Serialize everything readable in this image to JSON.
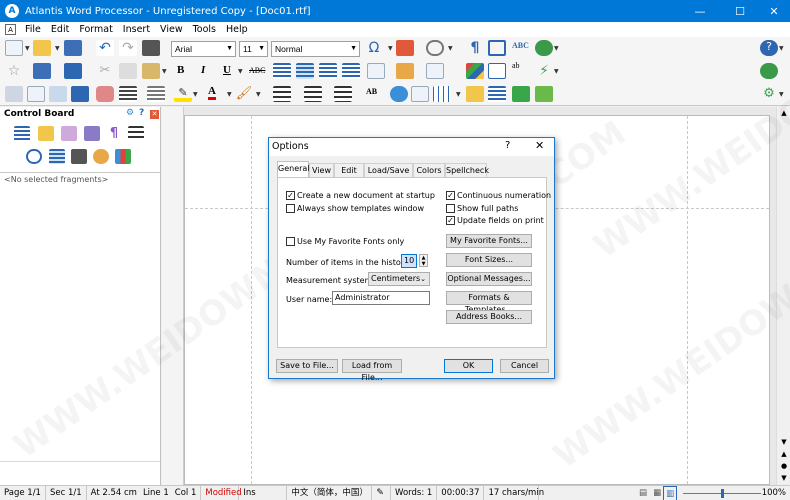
{
  "window": {
    "title": "Atlantis Word Processor - Unregistered Copy - [Doc01.rtf]",
    "app_logo_letter": "A",
    "minimize": "—",
    "maximize": "☐",
    "close": "✕"
  },
  "menu": {
    "items": [
      "File",
      "Edit",
      "Format",
      "Insert",
      "View",
      "Tools",
      "Help"
    ]
  },
  "toolbar": {
    "font_name": "Arial",
    "font_size": "11",
    "style": "Normal",
    "bold": "B",
    "italic": "I",
    "underline": "U",
    "strike": "ABC",
    "abc_spell": "ABC",
    "abc_change": "ab",
    "ab_superscript": "AB",
    "colors": {
      "accent": "#0078d7",
      "highlight": "#ffe000",
      "font_color": "#e00000"
    }
  },
  "control_board": {
    "title": "Control Board",
    "empty_text": "<No selected fragments>"
  },
  "dialog": {
    "title": "Options",
    "help": "?",
    "close": "✕",
    "tabs": [
      "General",
      "View",
      "Edit",
      "Load/Save",
      "Colors",
      "Spellcheck"
    ],
    "active_tab": "General",
    "checkboxes": [
      {
        "label": "Create a new document at startup",
        "checked": true
      },
      {
        "label": "Always show templates window",
        "checked": false
      },
      {
        "label": "Continuous numeration",
        "checked": true
      },
      {
        "label": "Show full paths",
        "checked": false
      },
      {
        "label": "Update fields on print",
        "checked": true
      },
      {
        "label": "Use My Favorite Fonts only",
        "checked": false
      }
    ],
    "history_label": "Number of items in the histories:",
    "history_value": "10",
    "measurement_label": "Measurement system:",
    "measurement_value": "Centimeters",
    "username_label": "User name:",
    "username_value": "Administrator",
    "side_buttons": [
      "My Favorite Fonts...",
      "Font Sizes...",
      "Optional Messages...",
      "Formats & Templates...",
      "Address Books..."
    ],
    "save_button": "Save to File...",
    "load_button": "Load from File...",
    "ok_button": "OK",
    "cancel_button": "Cancel"
  },
  "status": {
    "page": "Page 1/1",
    "sec": "Sec 1/1",
    "position": "At 2.54 cm",
    "line": "Line 1",
    "col": "Col 1",
    "modified": "Modified",
    "modified_color": "#d00000",
    "ins": "Ins",
    "language": "中文（简体，中国）",
    "words": "Words: 1",
    "time": "00:00:37",
    "speed": "17 chars/min",
    "zoom": "100%"
  },
  "watermark": "WWW.WEIDOWN.COM"
}
